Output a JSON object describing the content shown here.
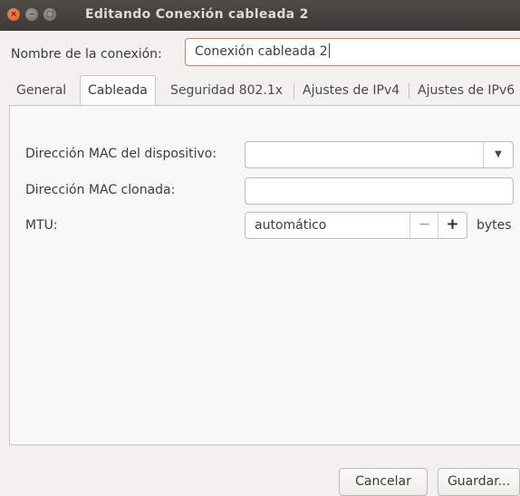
{
  "window": {
    "title": "Editando Conexión cableada 2",
    "buttons": {
      "close": "×",
      "minimize": "–",
      "maximize": "□"
    }
  },
  "connection": {
    "name_label": "Nombre de la conexión:",
    "name_value": "Conexión cableada 2"
  },
  "tabs": [
    {
      "label": "General"
    },
    {
      "label": "Cableada",
      "active": true
    },
    {
      "label": "Seguridad 802.1x"
    },
    {
      "label": "Ajustes de IPv4"
    },
    {
      "label": "Ajustes de IPv6"
    }
  ],
  "wired": {
    "mac_label": "Dirección MAC del dispositivo:",
    "mac_value": "",
    "mac_dropdown_icon": "chevron-down-icon",
    "mac_dropdown_glyph": "▼",
    "cloned_mac_label": "Dirección MAC clonada:",
    "cloned_mac_value": "",
    "mtu_label": "MTU:",
    "mtu_value": "automático",
    "mtu_decrement": "−",
    "mtu_increment": "+",
    "mtu_unit": "bytes"
  },
  "actions": {
    "cancel": "Cancelar",
    "save": "Guardar..."
  },
  "colors": {
    "titlebar": "#3c3b37",
    "close_button": "#e2511e",
    "focus_border": "#e07a4f",
    "background": "#f2f1f0"
  }
}
